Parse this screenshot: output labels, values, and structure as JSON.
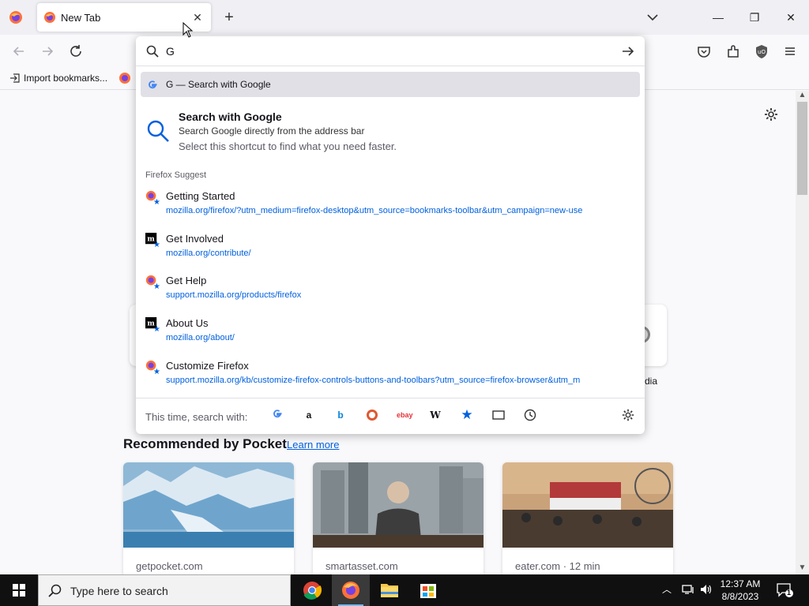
{
  "tabbar": {
    "tab_title": "New Tab",
    "new_tab_symbol": "+",
    "close_symbol": "✕"
  },
  "window": {
    "minimize": "—",
    "restore": "❐",
    "close": "✕"
  },
  "bookmarks": {
    "import_label": "Import bookmarks..."
  },
  "urlbar": {
    "value": "G",
    "heuristic": {
      "text": "G — Search with Google"
    },
    "tip": {
      "title": "Search with Google",
      "subtitle": "Search Google directly from the address bar",
      "hint": "Select this shortcut to find what you need faster."
    },
    "group_label": "Firefox Suggest",
    "results": [
      {
        "title": "Getting Started",
        "url": "mozilla.org/firefox/?utm_medium=firefox-desktop&utm_source=bookmarks-toolbar&utm_campaign=new-use",
        "icon": "firefox-icon"
      },
      {
        "title": "Get Involved",
        "url": "mozilla.org/contribute/",
        "icon": "mozilla-icon"
      },
      {
        "title": "Get Help",
        "url": "support.mozilla.org/products/firefox",
        "icon": "firefox-icon"
      },
      {
        "title": "About Us",
        "url": "mozilla.org/about/",
        "icon": "mozilla-icon"
      },
      {
        "title": "Customize Firefox",
        "url": "support.mozilla.org/kb/customize-firefox-controls-buttons-and-toolbars?utm_source=firefox-browser&utm_m",
        "icon": "firefox-icon"
      }
    ],
    "oneoff_label": "This time, search with:"
  },
  "content": {
    "topsite_label": "dia",
    "pocket_heading": "Recommended by Pocket",
    "pocket_learn_more": "Learn more",
    "cards": [
      {
        "source": "getpocket.com"
      },
      {
        "source": "smartasset.com"
      },
      {
        "source": "eater.com · 12 min"
      }
    ]
  },
  "taskbar": {
    "search_placeholder": "Type here to search",
    "time": "12:37 AM",
    "date": "8/8/2023",
    "notif_count": "1"
  },
  "colors": {
    "accent": "#0060df",
    "taskbar": "#101010"
  }
}
